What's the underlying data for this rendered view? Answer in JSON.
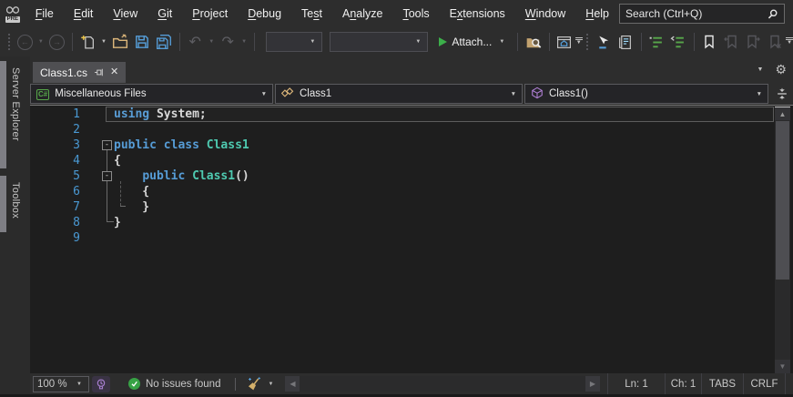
{
  "app": {
    "pre_badge": "PRE"
  },
  "menubar": {
    "items": [
      {
        "pre": "",
        "key": "F",
        "post": "ile"
      },
      {
        "pre": "",
        "key": "E",
        "post": "dit"
      },
      {
        "pre": "",
        "key": "V",
        "post": "iew"
      },
      {
        "pre": "",
        "key": "G",
        "post": "it"
      },
      {
        "pre": "",
        "key": "P",
        "post": "roject"
      },
      {
        "pre": "",
        "key": "D",
        "post": "ebug"
      },
      {
        "pre": "Te",
        "key": "s",
        "post": "t"
      },
      {
        "pre": "A",
        "key": "n",
        "post": "alyze"
      },
      {
        "pre": "",
        "key": "T",
        "post": "ools"
      },
      {
        "pre": "E",
        "key": "x",
        "post": "tensions"
      },
      {
        "pre": "",
        "key": "W",
        "post": "indow"
      },
      {
        "pre": "",
        "key": "H",
        "post": "elp"
      }
    ],
    "search": {
      "placeholder": "Search (Ctrl+Q)"
    }
  },
  "toolbar": {
    "attach_label": "Attach...",
    "combo1_value": "",
    "combo2_value": ""
  },
  "tabstrip": {
    "active_tab": "Class1.cs"
  },
  "navbar": {
    "dropdowns": [
      {
        "icon": "csharp-project-icon",
        "label": "Miscellaneous Files"
      },
      {
        "icon": "class-icon",
        "label": "Class1"
      },
      {
        "icon": "method-icon",
        "label": "Class1()"
      }
    ]
  },
  "icons": {
    "csharp_badge_text": "C#"
  },
  "sidebar": {
    "tabs": [
      {
        "label": "Server Explorer"
      },
      {
        "label": "Toolbox"
      }
    ]
  },
  "editor": {
    "lines": [
      {
        "num": 1,
        "current": true,
        "tokens": [
          {
            "t": "kw",
            "v": "using"
          },
          {
            "t": "pl",
            "v": " System;"
          }
        ]
      },
      {
        "num": 2,
        "tokens": []
      },
      {
        "num": 3,
        "fold": true,
        "tokens": [
          {
            "t": "kw",
            "v": "public"
          },
          {
            "t": "pl",
            "v": " "
          },
          {
            "t": "kw",
            "v": "class"
          },
          {
            "t": "pl",
            "v": " "
          },
          {
            "t": "ty",
            "v": "Class1"
          }
        ]
      },
      {
        "num": 4,
        "tokens": [
          {
            "t": "pl",
            "v": "{"
          }
        ]
      },
      {
        "num": 5,
        "fold": true,
        "tokens": [
          {
            "t": "pl",
            "v": "    "
          },
          {
            "t": "kw",
            "v": "public"
          },
          {
            "t": "pl",
            "v": " "
          },
          {
            "t": "ty",
            "v": "Class1"
          },
          {
            "t": "pl",
            "v": "()"
          }
        ]
      },
      {
        "num": 6,
        "tokens": [
          {
            "t": "pl",
            "v": "    {"
          }
        ]
      },
      {
        "num": 7,
        "tokens": [
          {
            "t": "pl",
            "v": "    }"
          }
        ]
      },
      {
        "num": 8,
        "tokens": [
          {
            "t": "pl",
            "v": "}"
          }
        ]
      },
      {
        "num": 9,
        "tokens": []
      }
    ]
  },
  "statusbar": {
    "zoom": "100 %",
    "message": "No issues found",
    "fields": [
      {
        "label": "Ln: 1",
        "interactable": false
      },
      {
        "label": "Ch: 1",
        "interactable": false
      },
      {
        "label": "TABS",
        "interactable": true
      },
      {
        "label": "CRLF",
        "interactable": true
      }
    ]
  },
  "colors": {
    "keyword": "#569CD6",
    "type": "#4EC9B0",
    "plain": "#D8D8D8",
    "line_number": "#4A99D3",
    "accent_green": "#57A64A",
    "folder_gold": "#DCB67A",
    "save_blue": "#559CD6",
    "method_purple": "#B180D7",
    "play_green": "#3CAF4A",
    "check_green": "#37A245"
  }
}
